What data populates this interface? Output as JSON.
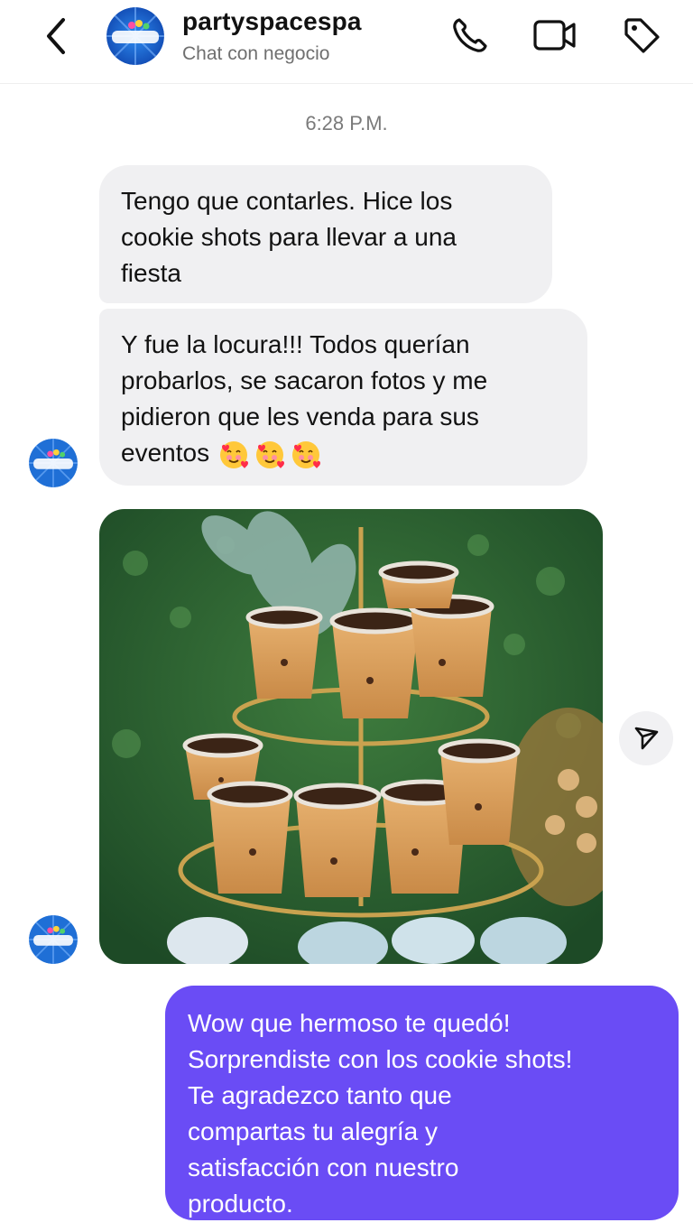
{
  "header": {
    "username": "partyspacespa",
    "subtitle": "Chat con negocio",
    "avatar_text": "Party Space",
    "icons": [
      "back-chevron-icon",
      "phone-icon",
      "video-camera-icon",
      "tag-icon"
    ]
  },
  "conversation": {
    "timestamp": "6:28 P.M.",
    "received": [
      {
        "text": "Tengo que contarles.  Hice los\ncookie shots para llevar a una\nfiesta"
      },
      {
        "text": "Y fue la locura!!! Todos querían\nprobarlos, se sacaron fotos y me\npidieron que les venda para sus\neventos",
        "emoji": [
          "smiling-face-with-hearts",
          "smiling-face-with-hearts",
          "smiling-face-with-hearts"
        ]
      }
    ],
    "photo": {
      "icon": "cookie-shots-photo",
      "share_icon": "send-icon"
    },
    "sent": {
      "text": "Wow que hermoso te quedó!\nSorprendiste con los cookie shots!\nTe agradezco tanto que\ncompartas tu alegría y\nsatisfacción con nuestro\nproducto."
    }
  },
  "colors": {
    "sent_bubble": "#6a4cf5",
    "received_bubble": "#f0f0f2",
    "avatar_ring": "#1f6fd6"
  }
}
